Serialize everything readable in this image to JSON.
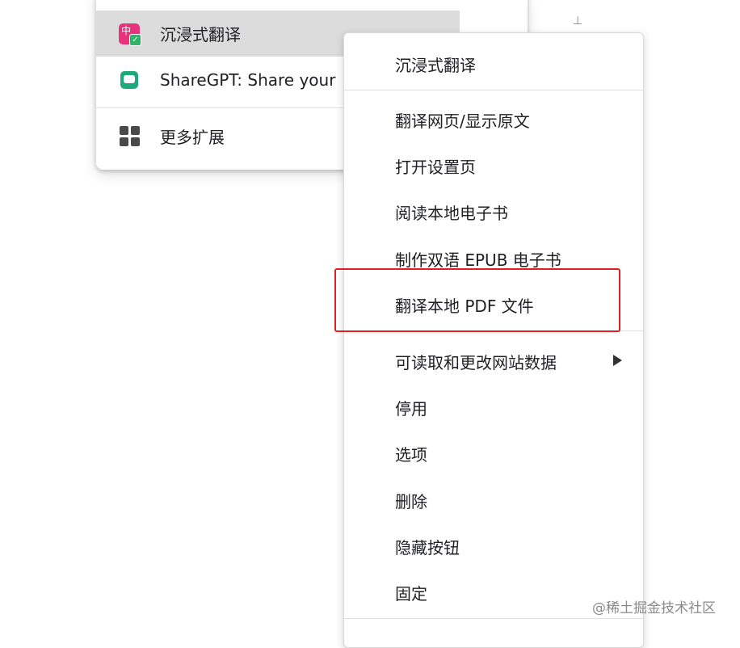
{
  "extensions_panel": {
    "items": [
      {
        "label": "沉浸式翻译",
        "icon": "immersive-translate-icon"
      },
      {
        "label": "ShareGPT: Share your",
        "icon": "sharegpt-icon"
      }
    ],
    "more": {
      "label": "更多扩展",
      "icon": "grid-icon"
    }
  },
  "context_menu": {
    "title": "沉浸式翻译",
    "group1": [
      "翻译网页/显示原文",
      "打开设置页",
      "阅读本地电子书",
      "制作双语 EPUB 电子书",
      "翻译本地 PDF 文件"
    ],
    "group2": [
      "可读取和更改网站数据",
      "停用",
      "选项",
      "删除",
      "隐藏按钮",
      "固定"
    ],
    "submenu_icon": "chevron-right-icon"
  },
  "annotation": {
    "color": "#e02020",
    "target": "翻译本地 PDF 文件"
  },
  "watermark": "@稀土掘金技术社区"
}
